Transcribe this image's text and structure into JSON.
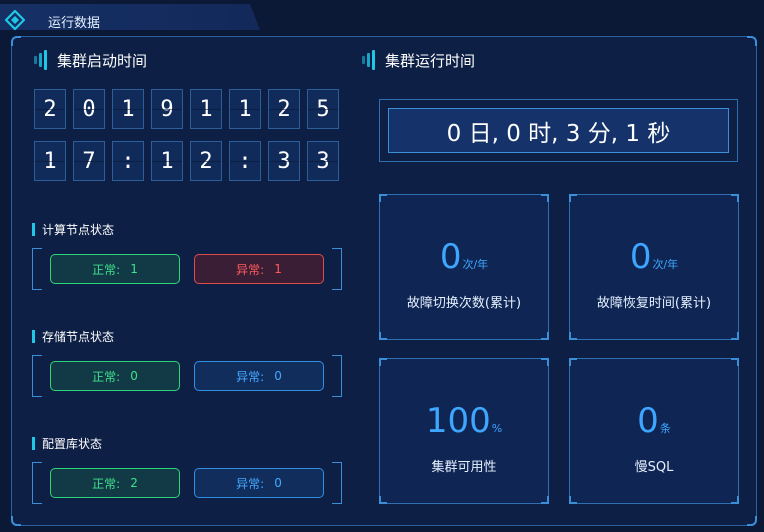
{
  "tab": {
    "title": "运行数据"
  },
  "left": {
    "title": "集群启动时间",
    "date_digits": [
      "2",
      "0",
      "1",
      "9",
      "1",
      "1",
      "2",
      "5"
    ],
    "time_digits": [
      "1",
      "7",
      ":",
      "1",
      "2",
      ":",
      "3",
      "3"
    ]
  },
  "status": [
    {
      "title": "计算节点状态",
      "normal_label": "正常:",
      "normal_value": "1",
      "abnormal_label": "异常:",
      "abnormal_value": "1"
    },
    {
      "title": "存储节点状态",
      "normal_label": "正常:",
      "normal_value": "0",
      "abnormal_label": "异常:",
      "abnormal_value": "0"
    },
    {
      "title": "配置库状态",
      "normal_label": "正常:",
      "normal_value": "2",
      "abnormal_label": "异常:",
      "abnormal_value": "0"
    }
  ],
  "right": {
    "title": "集群运行时间",
    "runtime": "0 日, 0 时, 3 分, 1 秒"
  },
  "stats": [
    {
      "value": "0",
      "unit": "次/年",
      "label": "故障切换次数(累计)"
    },
    {
      "value": "0",
      "unit": "次/年",
      "label": "故障恢复时间(累计)"
    },
    {
      "value": "100",
      "unit": "%",
      "label": "集群可用性"
    },
    {
      "value": "0",
      "unit": "条",
      "label": "慢SQL"
    }
  ],
  "colors": {
    "accent": "#1ec8e6",
    "value_blue": "#3ea6ff",
    "ok_green": "#3ee08a",
    "err_red": "#ff5a5a"
  }
}
